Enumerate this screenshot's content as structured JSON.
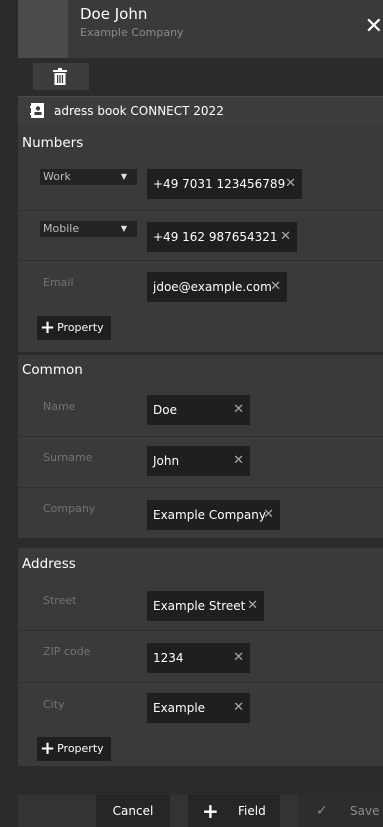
{
  "header": {
    "name": "Doe John",
    "company": "Example Company",
    "close_icon": "close-icon"
  },
  "toolbar": {
    "delete_icon": "trash-icon"
  },
  "addressbook": {
    "icon": "address-book-icon",
    "label": "adress book CONNECT 2022"
  },
  "sections": {
    "numbers": {
      "title": "Numbers",
      "rows": [
        {
          "type": "Work",
          "value": "+49 7031 123456789"
        },
        {
          "type": "Mobile",
          "value": "+49 162 987654321"
        }
      ],
      "email": {
        "label": "Email",
        "value": "jdoe@example.com"
      },
      "add_property": "Property"
    },
    "common": {
      "title": "Common",
      "name": {
        "label": "Name",
        "value": "Doe"
      },
      "surname": {
        "label": "Surname",
        "value": "John"
      },
      "company": {
        "label": "Company",
        "value": "Example Company"
      }
    },
    "address": {
      "title": "Address",
      "street": {
        "label": "Street",
        "value": "Example Street"
      },
      "zip": {
        "label": "ZIP code",
        "value": "1234"
      },
      "city": {
        "label": "City",
        "value": "Example"
      },
      "add_property": "Property"
    }
  },
  "footer": {
    "cancel": "Cancel",
    "field": "Field",
    "save": "Save"
  },
  "colors": {
    "panel": "#3a3a3a",
    "background": "#2b2b2b",
    "field": "#1f1f1f"
  }
}
